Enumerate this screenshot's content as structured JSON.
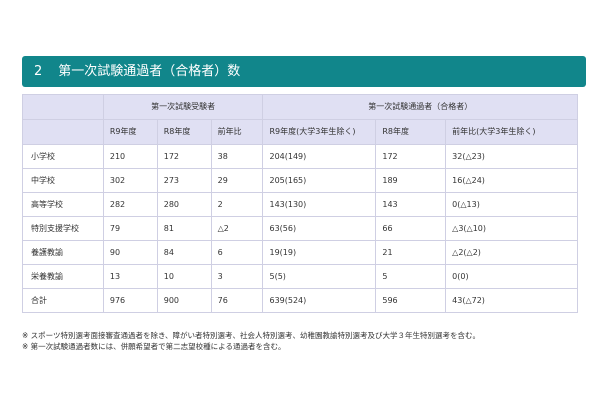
{
  "section": {
    "number": "2",
    "title": "第一次試験通過者（合格者）数"
  },
  "table": {
    "group_headers": {
      "applicants": "第一次試験受験者",
      "passers": "第一次試験通過者（合格者）"
    },
    "sub_headers": [
      "R9年度",
      "R8年度",
      "前年比",
      "R9年度(大学3年生除く)",
      "R8年度",
      "前年比(大学3年生除く)"
    ],
    "rows": [
      {
        "label": "小学校",
        "cells": [
          "210",
          "172",
          "38",
          "204(149)",
          "172",
          "32(△23)"
        ]
      },
      {
        "label": "中学校",
        "cells": [
          "302",
          "273",
          "29",
          "205(165)",
          "189",
          "16(△24)"
        ]
      },
      {
        "label": "高等学校",
        "cells": [
          "282",
          "280",
          "2",
          "143(130)",
          "143",
          "0(△13)"
        ]
      },
      {
        "label": "特別支援学校",
        "cells": [
          "79",
          "81",
          "△2",
          "63(56)",
          "66",
          "△3(△10)"
        ]
      },
      {
        "label": "養護教諭",
        "cells": [
          "90",
          "84",
          "6",
          "19(19)",
          "21",
          "△2(△2)"
        ]
      },
      {
        "label": "栄養教諭",
        "cells": [
          "13",
          "10",
          "3",
          "5(5)",
          "5",
          "0(0)"
        ]
      },
      {
        "label": "合計",
        "cells": [
          "976",
          "900",
          "76",
          "639(524)",
          "596",
          "43(△72)"
        ]
      }
    ]
  },
  "notes": [
    "※ スポーツ特別選考面接審査通過者を除き、障がい者特別選考、社会人特別選考、幼稚園教諭特別選考及び大学３年生特別選考を含む。",
    "※ 第一次試験通過者数には、併願希望者で第二志望校種による通過者を含む。"
  ],
  "colors": {
    "title_bar": "#11868b",
    "header_bg": "#e0e0f3",
    "border": "#cfcfe3"
  }
}
